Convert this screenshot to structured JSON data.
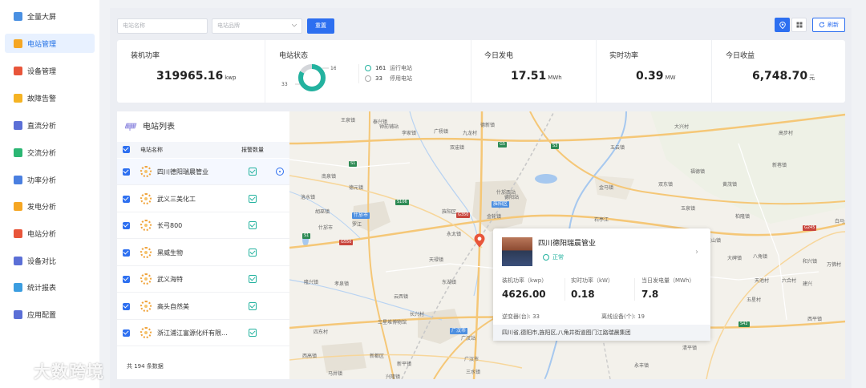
{
  "sidebar": {
    "items": [
      {
        "label": "全量大屏",
        "color": "#4a90e2"
      },
      {
        "label": "电站管理",
        "color": "#f5a623",
        "active": true
      },
      {
        "label": "设备管理",
        "color": "#e8553a"
      },
      {
        "label": "故障告警",
        "color": "#f5b323"
      },
      {
        "label": "直流分析",
        "color": "#5b6fd6"
      },
      {
        "label": "交流分析",
        "color": "#2bb673"
      },
      {
        "label": "功率分析",
        "color": "#4a7fe0"
      },
      {
        "label": "发电分析",
        "color": "#f5a623"
      },
      {
        "label": "电站分析",
        "color": "#e8553a"
      },
      {
        "label": "设备对比",
        "color": "#5b6fd6"
      },
      {
        "label": "统计报表",
        "color": "#3b9de0"
      },
      {
        "label": "应用配置",
        "color": "#5b6fd6"
      }
    ]
  },
  "toolbar": {
    "station_name_placeholder": "电站名称",
    "station_brand_placeholder": "电站品牌",
    "reset_label": "重置",
    "refresh_label": "刷新"
  },
  "stats": {
    "installed": {
      "label": "装机功率",
      "value": "319965.16",
      "unit": "kwp"
    },
    "status": {
      "label": "电站状态",
      "running_count": "161",
      "running_label": "运行电站",
      "stopped_count": "33",
      "stopped_label": "停用电站",
      "donut_outer": "161",
      "donut_inner": "33",
      "running_fraction": 0.83
    },
    "today_gen": {
      "label": "今日发电",
      "value": "17.51",
      "unit": "MWh"
    },
    "realtime": {
      "label": "实时功率",
      "value": "0.39",
      "unit": "MW"
    },
    "income": {
      "label": "今日收益",
      "value": "6,748.70",
      "unit": "元"
    }
  },
  "list": {
    "title": "电站列表",
    "col_name": "电站名称",
    "col_report": "报警数量",
    "rows": [
      {
        "name": "四川德阳瑞晨管业"
      },
      {
        "name": "武义三美化工"
      },
      {
        "name": "长弓800"
      },
      {
        "name": "黑威生物"
      },
      {
        "name": "武义海特"
      },
      {
        "name": "高头自然美"
      },
      {
        "name": "浙江浦江富源化纤有限..."
      }
    ],
    "footer": "共 194 条数据"
  },
  "map": {
    "labels": [
      "王泉镇",
      "泰兴镇",
      "钟前铺站",
      "德新镇",
      "广杨镇",
      "李家镇",
      "九龙村",
      "双庙镇",
      "五云镇",
      "高步村",
      "新巷镇",
      "大兴村",
      "金马镇",
      "罗江",
      "什邡市",
      "什邡西站",
      "德阳站",
      "旌阳区",
      "金轮镇",
      "胡巫镇",
      "洛水镇",
      "南泉镇",
      "德元镇",
      "永太镇",
      "玉泉镇",
      "柏隆镇",
      "连山镇",
      "大碑镇",
      "天禄镇",
      "东湖镇",
      "孝泉镇",
      "隆兴镇",
      "云西镇",
      "长兴村",
      "三星堆博物馆",
      "广汉站",
      "广汉市",
      "三水镇",
      "新平镇",
      "四东村",
      "西高镇",
      "马井镇",
      "新都区",
      "兴隆镇",
      "永丰镇",
      "清平镇",
      "八角镇",
      "六合村",
      "建兴",
      "白马关",
      "双东镇",
      "高坪镇",
      "石亭江",
      "黄茂镇",
      "福德镇",
      "和兴镇",
      "西平镇",
      "五星村",
      "天池村",
      "万佛村"
    ],
    "popup": {
      "name": "四川德阳瑞晨管业",
      "status": "正常",
      "m1_label": "装机功率（kwp）",
      "m1_value": "4626.00",
      "m2_label": "实时功率（kW）",
      "m2_value": "0.18",
      "m3_label": "当日发电量（MWh）",
      "m3_value": "7.8",
      "inv_label": "逆变器(台):",
      "inv_value": "33",
      "offline_label": "离线设备(个):",
      "offline_value": "19",
      "address": "四川省,德阳市,旌阳区,八角井街道图门江路瑞晨集团"
    }
  },
  "watermark": "大数跨境"
}
